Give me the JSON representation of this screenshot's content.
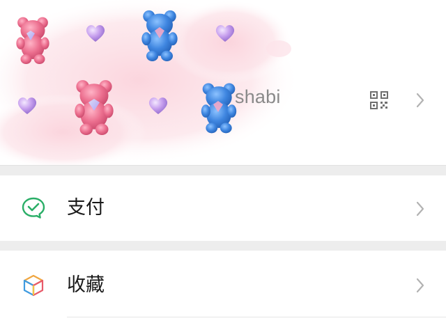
{
  "profile": {
    "username": "shabi",
    "wallpaper": {
      "pink_bear_color": "#e86a8a",
      "blue_bear_color": "#3b82d9",
      "heart_color": "#b48ae0",
      "blush_color": "#fbd9e0"
    },
    "qr_icon": "qr-code-icon",
    "arrow_icon": "chevron-right-icon"
  },
  "menu": {
    "items": [
      {
        "label": "支付",
        "icon": "wechat-pay-icon",
        "icon_color": "#2aae67"
      },
      {
        "label": "收藏",
        "icon": "favorites-cube-icon"
      }
    ]
  },
  "colors": {
    "background": "#ffffff",
    "separator": "#ededed",
    "label": "#191919",
    "muted": "#8a8a8a",
    "chevron": "#b2b2b2"
  }
}
